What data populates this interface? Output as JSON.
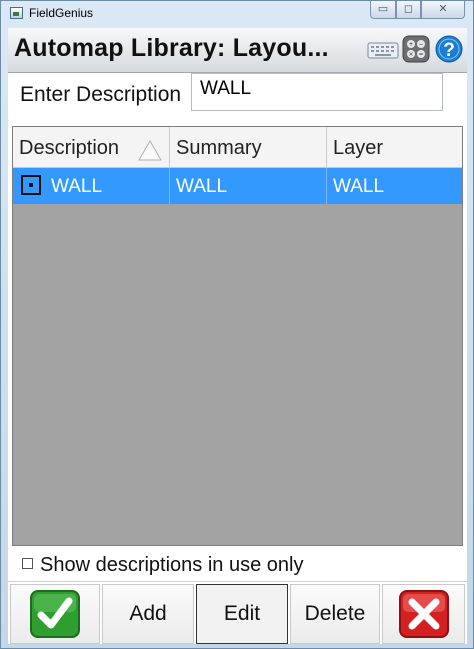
{
  "window": {
    "title": "FieldGenius"
  },
  "header": {
    "title": "Automap Library: Layou..."
  },
  "form": {
    "description_label": "Enter Description",
    "description_value": "WALL"
  },
  "table": {
    "columns": [
      "Description",
      "Summary",
      "Layer"
    ],
    "rows": [
      {
        "description": "WALL",
        "summary": "WALL",
        "layer": "WALL",
        "selected": true
      }
    ]
  },
  "filter": {
    "label": "Show descriptions in use only",
    "checked": false
  },
  "buttons": {
    "add": "Add",
    "edit": "Edit",
    "delete": "Delete"
  },
  "icons": {
    "app": "app-icon",
    "keyboard": "keyboard-icon",
    "calculator": "calculator-icon",
    "help": "help-icon",
    "sort": "sort-ascending-icon",
    "point": "point-symbol-icon",
    "ok": "checkmark-icon",
    "cancel": "close-x-icon"
  },
  "colors": {
    "selection": "#3399ff",
    "grid_background": "#a3a3a3",
    "ok_green": "#2e9e2e",
    "cancel_red": "#d42020",
    "help_blue": "#1a7fd4"
  }
}
